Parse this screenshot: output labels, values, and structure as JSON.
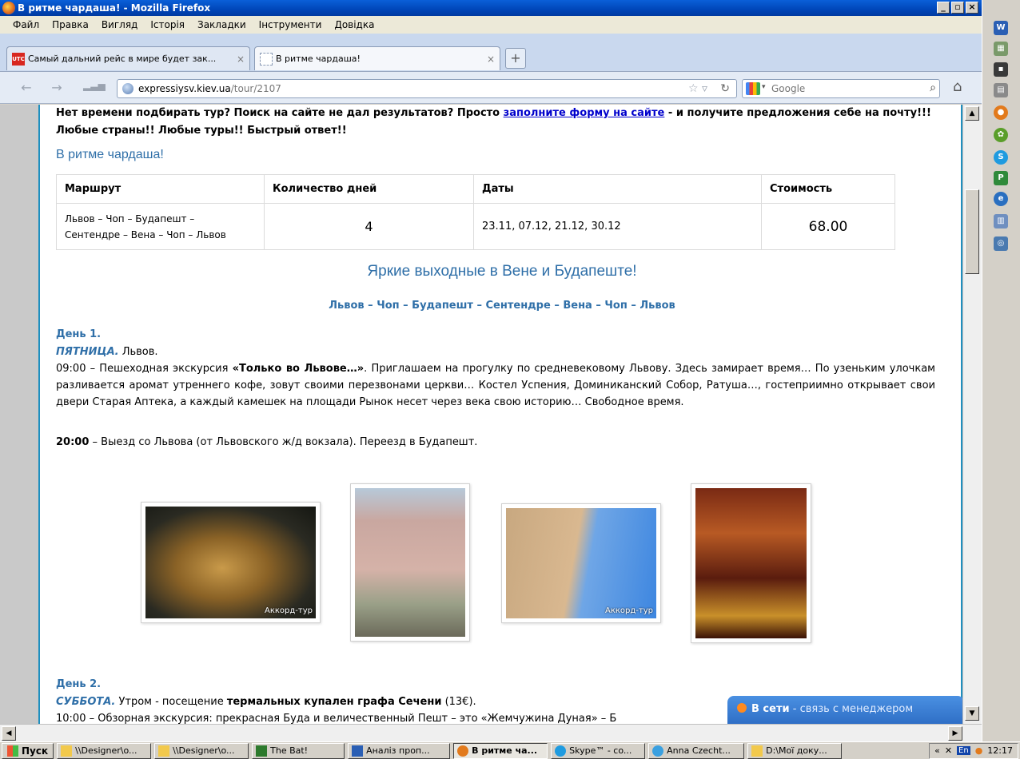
{
  "window": {
    "title": "В ритме чардаша! - Mozilla Firefox"
  },
  "menu": [
    "Файл",
    "Правка",
    "Вигляд",
    "Історія",
    "Закладки",
    "Інструменти",
    "Довідка"
  ],
  "tabs": [
    {
      "label": "Самый дальний рейс в мире будет зак...",
      "favicon": "utc-favicon"
    },
    {
      "label": "В ритме чардаша!",
      "favicon": "blank-favicon"
    }
  ],
  "nav": {
    "url_host": "expressiysv.kiev.ua",
    "url_path": "/tour/2107",
    "search_placeholder": "Google"
  },
  "page": {
    "promo_before": "Нет времени подбирать тур? Поиск на сайте не дал результатов? Просто ",
    "promo_link": "заполните форму на сайте",
    "promo_after": " - и получите предложения себе на почту!!! Любые страны!! Любые туры!! Быстрый ответ!!",
    "tour_title": "В ритме чардаша!",
    "table": {
      "headers": [
        "Маршрут",
        "Количество дней",
        "Даты",
        "Стоимость"
      ],
      "route_line1": "Львов – Чоп – Будапешт –",
      "route_line2": "Сентендре – Вена – Чоп – Львов",
      "days": "4",
      "dates": "23.11, 07.12, 21.12, 30.12",
      "price": "68.00"
    },
    "subtitle": "Яркие выходные в Вене и Будапеште!",
    "route_heading": "Львов – Чоп – Будапешт – Сентендре – Вена – Чоп – Львов",
    "day1": {
      "heading": "День 1.",
      "weekday": "ПЯТНИЦА.",
      "weekday_rest": " Львов.",
      "p1_time": "09:00 – Пешеходная экскурсия ",
      "p1_bold": "«Только во Львове…»",
      "p1_rest": ". Приглашаем на прогулку по средневековому Львову. Здесь замирает время… По узеньким улочкам разливается аромат утреннего кофе, зовут своими перезвонами церкви… Костел Успения, Доминиканский Собор, Ратуша…, гостеприимно открывает свои двери Старая Аптека, а каждый камешек на площади Рынок несет через века свою историю… Свободное время.",
      "p2_time": "20:00",
      "p2_rest": " – Выезд со Львова (от Львовского ж/д вокзала). Переезд в Будапешт."
    },
    "photos": [
      {
        "name": "lion-statue-photo",
        "watermark": "Аккорд-тур"
      },
      {
        "name": "lviv-street-photo",
        "watermark": ""
      },
      {
        "name": "budapest-building-photo",
        "watermark": "Аккорд-тур"
      },
      {
        "name": "old-pharmacy-photo",
        "watermark": ""
      }
    ],
    "day2": {
      "heading": "День 2.",
      "weekday": "СУББОТА.",
      "rest_before": " Утром - посещение ",
      "rest_bold": "термальных купален графа Сечени",
      "rest_after": " (13€).",
      "p1_partial": "10:00 – Обзорная экскурсия: прекрасная Буда и величественный Пешт – это «Жемчужина Дуная» – Б"
    },
    "chat": {
      "strong": "В сети",
      "rest": " - связь с менеджером"
    }
  },
  "taskbar": {
    "start": "Пуск",
    "tasks": [
      {
        "label": "\\\\Designer\\o...",
        "icon": "folder-icon"
      },
      {
        "label": "\\\\Designer\\o...",
        "icon": "folder-icon"
      },
      {
        "label": "The Bat!",
        "icon": "thebat-icon"
      },
      {
        "label": "Аналіз проп...",
        "icon": "word-icon"
      },
      {
        "label": "В ритме ча...",
        "icon": "firefox-icon",
        "active": true
      },
      {
        "label": "Skype™ - co...",
        "icon": "skype-icon"
      },
      {
        "label": "Anna Czecht...",
        "icon": "chat-icon"
      },
      {
        "label": "D:\\Мої доку...",
        "icon": "folder-icon"
      }
    ],
    "tray_lang": "En",
    "clock": "12:17"
  }
}
